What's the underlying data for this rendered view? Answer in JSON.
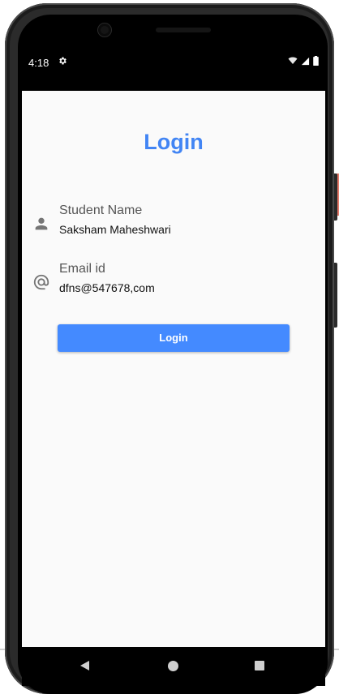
{
  "status_bar": {
    "time": "4:18",
    "settings_icon": "gear-icon",
    "wifi_icon": "wifi-icon",
    "signal_icon": "signal-icon",
    "battery_icon": "battery-icon"
  },
  "screen": {
    "title": "Login",
    "fields": [
      {
        "label": "Student Name",
        "value": "Saksham Maheshwari",
        "icon": "person-icon"
      },
      {
        "label": "Email id",
        "value": "dfns@547678,com",
        "icon": "at-sign-icon"
      }
    ],
    "login_button_label": "Login"
  },
  "nav_bar": {
    "back_icon": "back-icon",
    "home_icon": "home-icon",
    "recents_icon": "recents-icon"
  },
  "colors": {
    "accent": "#4285f4",
    "button": "#448aff",
    "screen_bg": "#fafafa"
  }
}
